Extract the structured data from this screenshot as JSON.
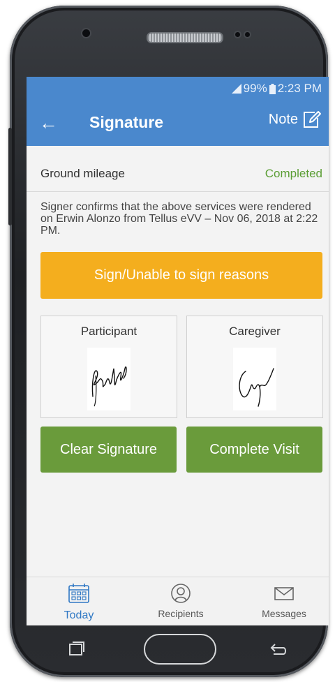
{
  "status_bar": {
    "battery": "99%",
    "time": "2:23 PM"
  },
  "app_bar": {
    "title": "Signature",
    "note_label": "Note"
  },
  "service": {
    "name": "Ground mileage",
    "status": "Completed"
  },
  "confirmation_text": "Signer confirms that the above services were rendered on Erwin Alonzo from Tellus eVV – Nov 06, 2018 at 2:22 PM.",
  "sign_button": "Sign/Unable to sign reasons",
  "signatures": {
    "participant_label": "Participant",
    "caregiver_label": "Caregiver"
  },
  "actions": {
    "clear": "Clear Signature",
    "complete": "Complete Visit"
  },
  "bottom_nav": {
    "today": "Today",
    "recipients": "Recipients",
    "messages": "Messages"
  },
  "colors": {
    "primary": "#4a88cd",
    "accent": "#f4ae1e",
    "success": "#6a9b3b",
    "completed_text": "#5b9e35",
    "nav_active": "#2f78c4"
  }
}
